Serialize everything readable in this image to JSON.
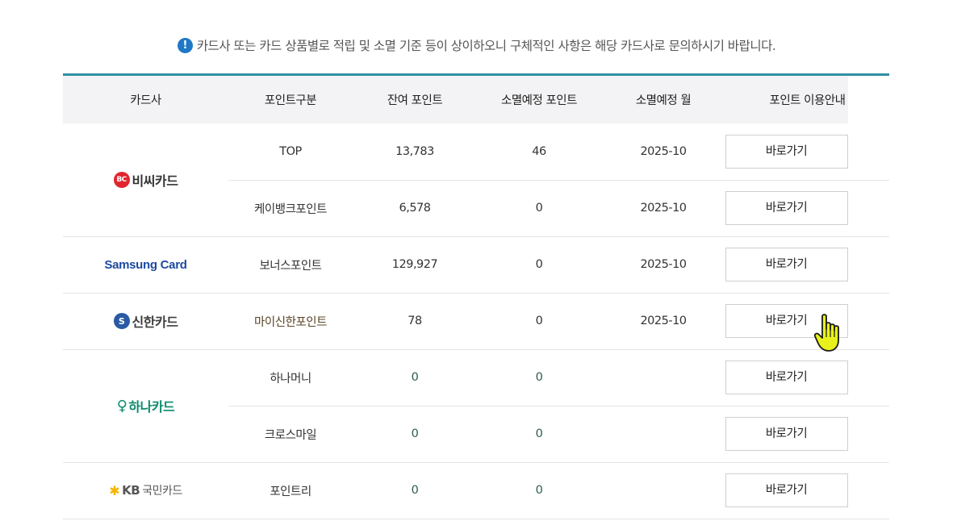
{
  "notice": {
    "icon": "info-icon",
    "text": "카드사 또는 카드 상품별로 적립 및 소멸 기준 등이 상이하오니 구체적인 사항은 해당 카드사로 문의하시기 바랍니다."
  },
  "table": {
    "headers": [
      "카드사",
      "포인트구분",
      "잔여 포인트",
      "소멸예정 포인트",
      "소멸예정 월",
      "포인트 이용안내"
    ],
    "button_label": "바로가기",
    "issuers": [
      {
        "logo_text": "비씨카드",
        "logo_icon": "bc",
        "rows": [
          {
            "type": "TOP",
            "remaining": "13,783",
            "expiring": "46",
            "month": "2025-10"
          },
          {
            "type": "케이뱅크포인트",
            "remaining": "6,578",
            "expiring": "0",
            "month": "2025-10"
          }
        ]
      },
      {
        "logo_text": "Samsung Card",
        "rows": [
          {
            "type": "보너스포인트",
            "remaining": "129,927",
            "expiring": "0",
            "month": "2025-10"
          }
        ]
      },
      {
        "logo_text": "신한카드",
        "rows": [
          {
            "type": "마이신한포인트",
            "remaining": "78",
            "expiring": "0",
            "month": "2025-10"
          }
        ]
      },
      {
        "logo_text": "하나카드",
        "rows": [
          {
            "type": "하나머니",
            "remaining": "0",
            "expiring": "0",
            "month": ""
          },
          {
            "type": "크로스마일",
            "remaining": "0",
            "expiring": "0",
            "month": ""
          }
        ]
      },
      {
        "logo_text": "KB",
        "logo_text_2": "국민카드",
        "rows": [
          {
            "type": "포인트리",
            "remaining": "0",
            "expiring": "0",
            "month": ""
          }
        ]
      }
    ]
  },
  "colors": {
    "accent": "#2f8fa3",
    "header_bg": "#f3f3f5",
    "info_blue": "#1f78c7",
    "bc_red": "#e0262f",
    "samsung_blue": "#1d4a9e",
    "hana_green": "#0a8a6d",
    "kb_yellow": "#f5b400",
    "cursor_yellow": "#e8f21a"
  },
  "cursor": {
    "icon": "hand-pointer-icon"
  }
}
